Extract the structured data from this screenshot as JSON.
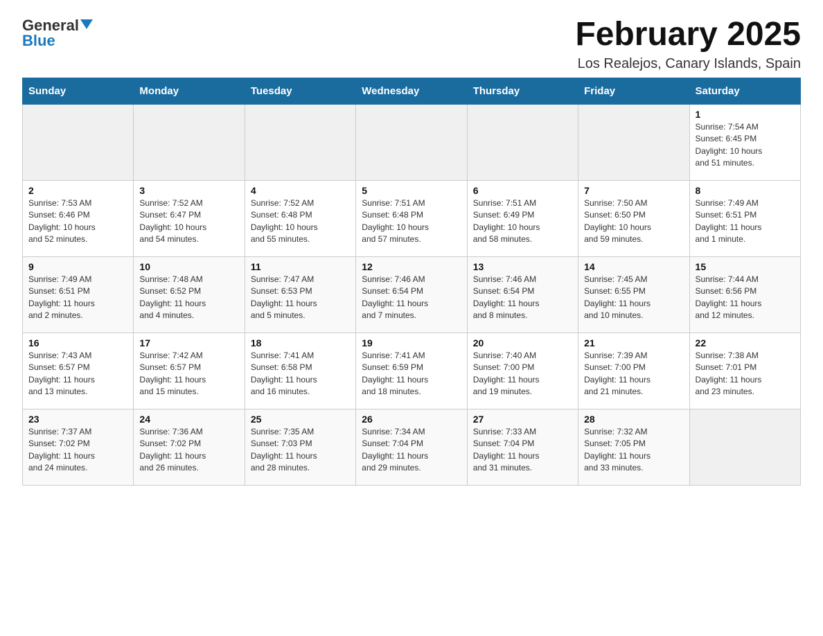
{
  "header": {
    "logo_general": "General",
    "logo_blue": "Blue",
    "main_title": "February 2025",
    "subtitle": "Los Realejos, Canary Islands, Spain"
  },
  "days_of_week": [
    "Sunday",
    "Monday",
    "Tuesday",
    "Wednesday",
    "Thursday",
    "Friday",
    "Saturday"
  ],
  "weeks": [
    {
      "days": [
        {
          "num": "",
          "info": ""
        },
        {
          "num": "",
          "info": ""
        },
        {
          "num": "",
          "info": ""
        },
        {
          "num": "",
          "info": ""
        },
        {
          "num": "",
          "info": ""
        },
        {
          "num": "",
          "info": ""
        },
        {
          "num": "1",
          "info": "Sunrise: 7:54 AM\nSunset: 6:45 PM\nDaylight: 10 hours\nand 51 minutes."
        }
      ]
    },
    {
      "days": [
        {
          "num": "2",
          "info": "Sunrise: 7:53 AM\nSunset: 6:46 PM\nDaylight: 10 hours\nand 52 minutes."
        },
        {
          "num": "3",
          "info": "Sunrise: 7:52 AM\nSunset: 6:47 PM\nDaylight: 10 hours\nand 54 minutes."
        },
        {
          "num": "4",
          "info": "Sunrise: 7:52 AM\nSunset: 6:48 PM\nDaylight: 10 hours\nand 55 minutes."
        },
        {
          "num": "5",
          "info": "Sunrise: 7:51 AM\nSunset: 6:48 PM\nDaylight: 10 hours\nand 57 minutes."
        },
        {
          "num": "6",
          "info": "Sunrise: 7:51 AM\nSunset: 6:49 PM\nDaylight: 10 hours\nand 58 minutes."
        },
        {
          "num": "7",
          "info": "Sunrise: 7:50 AM\nSunset: 6:50 PM\nDaylight: 10 hours\nand 59 minutes."
        },
        {
          "num": "8",
          "info": "Sunrise: 7:49 AM\nSunset: 6:51 PM\nDaylight: 11 hours\nand 1 minute."
        }
      ]
    },
    {
      "days": [
        {
          "num": "9",
          "info": "Sunrise: 7:49 AM\nSunset: 6:51 PM\nDaylight: 11 hours\nand 2 minutes."
        },
        {
          "num": "10",
          "info": "Sunrise: 7:48 AM\nSunset: 6:52 PM\nDaylight: 11 hours\nand 4 minutes."
        },
        {
          "num": "11",
          "info": "Sunrise: 7:47 AM\nSunset: 6:53 PM\nDaylight: 11 hours\nand 5 minutes."
        },
        {
          "num": "12",
          "info": "Sunrise: 7:46 AM\nSunset: 6:54 PM\nDaylight: 11 hours\nand 7 minutes."
        },
        {
          "num": "13",
          "info": "Sunrise: 7:46 AM\nSunset: 6:54 PM\nDaylight: 11 hours\nand 8 minutes."
        },
        {
          "num": "14",
          "info": "Sunrise: 7:45 AM\nSunset: 6:55 PM\nDaylight: 11 hours\nand 10 minutes."
        },
        {
          "num": "15",
          "info": "Sunrise: 7:44 AM\nSunset: 6:56 PM\nDaylight: 11 hours\nand 12 minutes."
        }
      ]
    },
    {
      "days": [
        {
          "num": "16",
          "info": "Sunrise: 7:43 AM\nSunset: 6:57 PM\nDaylight: 11 hours\nand 13 minutes."
        },
        {
          "num": "17",
          "info": "Sunrise: 7:42 AM\nSunset: 6:57 PM\nDaylight: 11 hours\nand 15 minutes."
        },
        {
          "num": "18",
          "info": "Sunrise: 7:41 AM\nSunset: 6:58 PM\nDaylight: 11 hours\nand 16 minutes."
        },
        {
          "num": "19",
          "info": "Sunrise: 7:41 AM\nSunset: 6:59 PM\nDaylight: 11 hours\nand 18 minutes."
        },
        {
          "num": "20",
          "info": "Sunrise: 7:40 AM\nSunset: 7:00 PM\nDaylight: 11 hours\nand 19 minutes."
        },
        {
          "num": "21",
          "info": "Sunrise: 7:39 AM\nSunset: 7:00 PM\nDaylight: 11 hours\nand 21 minutes."
        },
        {
          "num": "22",
          "info": "Sunrise: 7:38 AM\nSunset: 7:01 PM\nDaylight: 11 hours\nand 23 minutes."
        }
      ]
    },
    {
      "days": [
        {
          "num": "23",
          "info": "Sunrise: 7:37 AM\nSunset: 7:02 PM\nDaylight: 11 hours\nand 24 minutes."
        },
        {
          "num": "24",
          "info": "Sunrise: 7:36 AM\nSunset: 7:02 PM\nDaylight: 11 hours\nand 26 minutes."
        },
        {
          "num": "25",
          "info": "Sunrise: 7:35 AM\nSunset: 7:03 PM\nDaylight: 11 hours\nand 28 minutes."
        },
        {
          "num": "26",
          "info": "Sunrise: 7:34 AM\nSunset: 7:04 PM\nDaylight: 11 hours\nand 29 minutes."
        },
        {
          "num": "27",
          "info": "Sunrise: 7:33 AM\nSunset: 7:04 PM\nDaylight: 11 hours\nand 31 minutes."
        },
        {
          "num": "28",
          "info": "Sunrise: 7:32 AM\nSunset: 7:05 PM\nDaylight: 11 hours\nand 33 minutes."
        },
        {
          "num": "",
          "info": ""
        }
      ]
    }
  ]
}
